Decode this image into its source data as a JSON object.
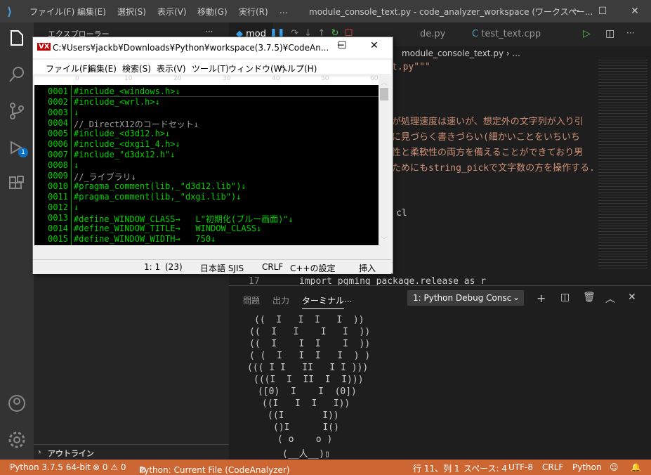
{
  "vscode": {
    "menu": [
      "ファイル(F)",
      "編集(E)",
      "選択(S)",
      "表示(V)",
      "移動(G)",
      "実行(R)",
      "..."
    ],
    "title": "module_console_text.py - code_analyzer_workspace (ワークスペー...",
    "sidebar_header": "エクスプローラー",
    "outline_label": "アウトライン",
    "tabs": [
      "mod",
      "de.py",
      "test_text.cpp"
    ],
    "breadcrumb": "module_console_text.py › ...",
    "editor_lines": [
      "t.py\"\"\"",
      "が処理速度は速いが、想定外の文字列が入り引",
      "に見づらく書きづらい(細かいことをいちいち",
      "性と柔軟性の両方を備えることができており男",
      "ためにもstring_pickで文字数の方を操作する."
    ],
    "editor_line_17_num": "17",
    "editor_line_17": "import pgming package.release as r",
    "editor_cl": "cl",
    "panel_tabs": [
      "問題",
      "出力",
      "ターミナル",
      "..."
    ],
    "terminal_select": "1: Python Debug Consc",
    "terminal_art": [
      "((  I   I  I   I  ))",
      "((  I   I    I   I  ))",
      "((  I    I  I    I  ))",
      "( (  I   I  I   I  ) )",
      "((( I I   II   I I )))",
      "(((I  I  II  I  I)))",
      "([0)  I    I  (0])",
      "((I   I  I   I))",
      "((I       I))",
      "()I      I()",
      "( o    o )",
      "(__人__)▯"
    ],
    "status": {
      "python": "Python 3.7.5 64-bit",
      "problems": "⊗ 0 ⚠ 0",
      "run": "Python: Current File (CodeAnalyzer)",
      "position": "行 11、列 1",
      "spaces": "スペース: 4",
      "encoding": "UTF-8",
      "eol": "CRLF",
      "lang": "Python"
    },
    "badge": "1"
  },
  "console_window": {
    "title": "C:¥Users¥jackb¥Downloads¥Python¥workspace(3.7.5)¥CodeAn...",
    "menu": [
      "ファイル(F)",
      "編集(E)",
      "検索(S)",
      "表示(V)",
      "ツール(T)",
      "ウィンドウ(W)",
      "ヘルプ(H)"
    ],
    "ruler": [
      "0",
      "10",
      "20",
      "30",
      "40",
      "50",
      "60"
    ],
    "line_numbers": [
      "0001",
      "0002",
      "0003",
      "0004",
      "0005",
      "0006",
      "0007",
      "0008",
      "0009",
      "0010",
      "0011",
      "0012",
      "0013",
      "0014",
      "0015"
    ],
    "lines": [
      "#include_<windows.h>↓",
      "#include_<wrl.h>↓",
      "↓",
      "//_DirectX12のコードセット↓",
      "#include_<d3d12.h>↓",
      "#include_<dxgi1_4.h>↓",
      "#include_\"d3dx12.h\"↓",
      "↓",
      "//_ライブラリ↓",
      "#pragma_comment(lib,_\"d3d12.lib\")↓",
      "#pragma_comment(lib,_\"dxgi.lib\")↓",
      "↓",
      "#define_WINDOW_CLASS→   L\"初期化(ブルー画面)\"↓",
      "#define_WINDOW_TITLE→   WINDOW_CLASS↓",
      "#define_WINDOW_WIDTH→   750↓"
    ],
    "status": {
      "pos": "1: 1",
      "paren": "(23)",
      "lang": "日本語 SJIS",
      "eol": "CRLF",
      "setting": "C++の設定",
      "mode": "挿入"
    }
  },
  "colors": {
    "accent": "#cc6633",
    "code": "#00d000"
  }
}
